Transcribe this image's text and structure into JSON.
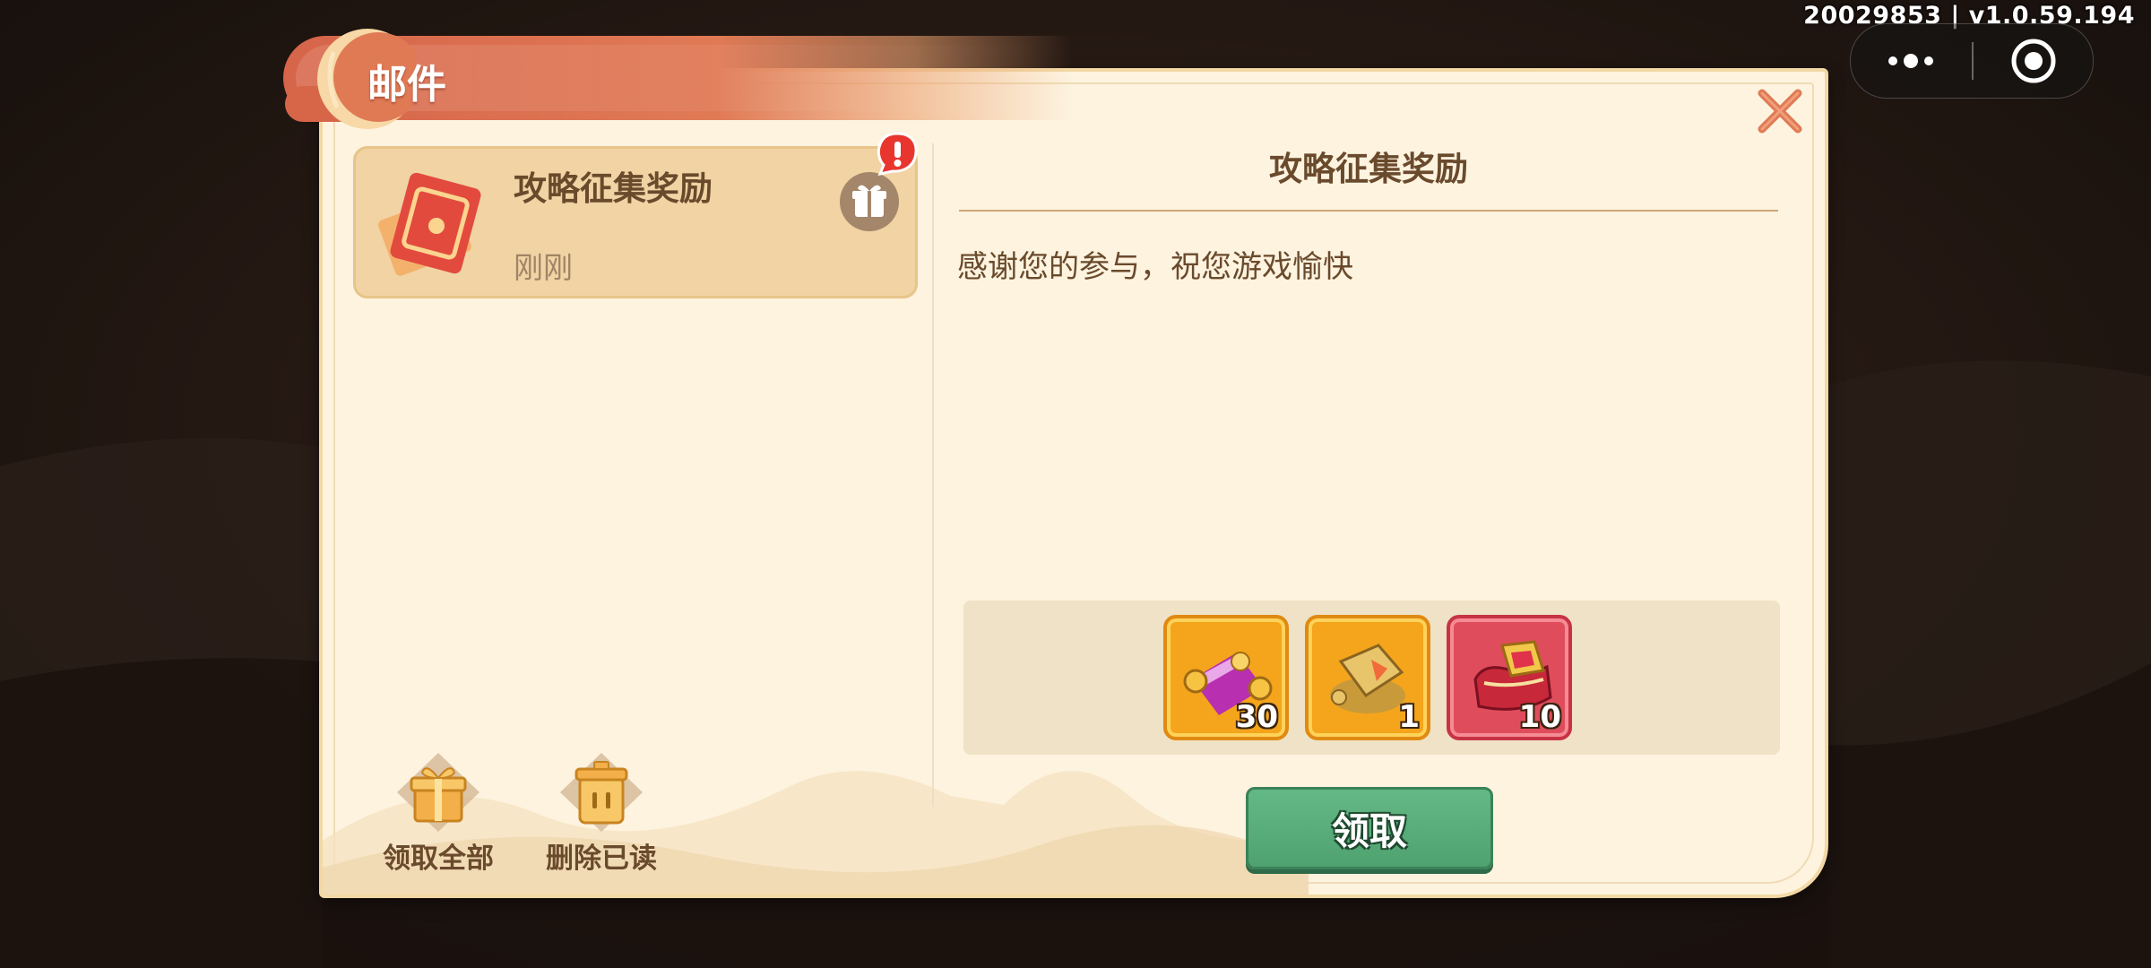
{
  "system": {
    "version": "20029853 | v1.0.59.194",
    "capsule": {
      "more_icon": "more-dots-icon",
      "target_icon": "target-icon"
    }
  },
  "window": {
    "title": "邮件",
    "close_icon": "close-x-icon"
  },
  "mail_list": [
    {
      "title": "攻略征集奖励",
      "time": "刚刚",
      "icon": "red-envelope-icon",
      "has_attachment": true,
      "unread_alert": "!"
    }
  ],
  "detail": {
    "title": "攻略征集奖励",
    "body": "感谢您的参与，祝您游戏愉快",
    "rewards": [
      {
        "icon": "purple-scroll-icon",
        "count": "30",
        "rarity": "gold"
      },
      {
        "icon": "gold-treasure-icon",
        "count": "1",
        "rarity": "gold"
      },
      {
        "icon": "red-chest-icon",
        "count": "10",
        "rarity": "red"
      }
    ],
    "claim_label": "领取"
  },
  "actions": {
    "claim_all_label": "领取全部",
    "delete_read_label": "删除已读"
  },
  "colors": {
    "ribbon": "#d6654a",
    "panel_bg": "#fdf3df",
    "text_brown": "#6a4a2c",
    "claim_green": "#4fa26f"
  }
}
